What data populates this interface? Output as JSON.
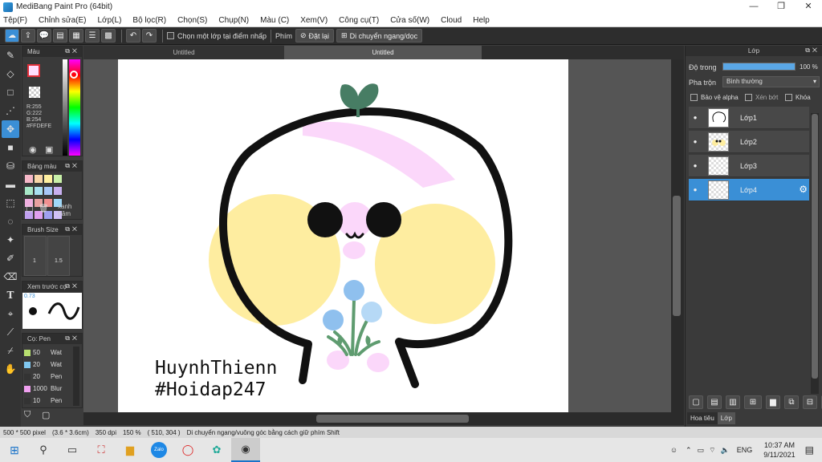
{
  "window": {
    "title": "MediBang Paint Pro (64bit)",
    "controls": [
      "—",
      "❐",
      "✕"
    ]
  },
  "menu": [
    "Tệp(F)",
    "Chỉnh sửa(E)",
    "Lớp(L)",
    "Bộ lọc(R)",
    "Chọn(S)",
    "Chụp(N)",
    "Màu (C)",
    "Xem(V)",
    "Công cụ(T)",
    "Cửa số(W)",
    "Cloud",
    "Help"
  ],
  "toolbar": {
    "sample_label": "Chọn một lớp tại điểm nhấp",
    "key_label": "Phím",
    "reset_label": "Đặt lại",
    "move_label": "Di chuyển ngang/dọc"
  },
  "tabs": [
    "Untitled",
    "Untitled"
  ],
  "color_panel": {
    "title": "Màu",
    "r": "R:255",
    "g": "G:222",
    "b": "B:254",
    "hex": "#FFDEFE",
    "primary": "#ffdefe",
    "secondary": "#e0303a"
  },
  "palette_panel": {
    "title": "Bảng màu",
    "name": "xanh trăm",
    "colors": [
      "#f6b8c8",
      "#f8d6a8",
      "#fff0a0",
      "#c8f0a8",
      "#a8e8c8",
      "#a8e0f0",
      "#a8c8f8",
      "#c8b0f0",
      "#f0b0e0",
      "#e8a0a0",
      "#f09090",
      "#a0d8f8",
      "#c0a0f0",
      "#e0a0f0",
      "#a0a0f0",
      "#d0c0f8"
    ]
  },
  "brush_size_panel": {
    "title": "Brush Size",
    "sizes": [
      "1",
      "1.5"
    ]
  },
  "preview_panel": {
    "title": "Xem trước cọ",
    "value": "0.73"
  },
  "brush_panel": {
    "title": "Cọ: Pen",
    "items": [
      {
        "size": "50",
        "name": "Wat",
        "color": "#b8e070"
      },
      {
        "size": "20",
        "name": "Wat",
        "color": "#80c8f0"
      },
      {
        "size": "20",
        "name": "Pen",
        "color": "#333333"
      },
      {
        "size": "1000",
        "name": "Blur",
        "color": "#f0a0f0"
      },
      {
        "size": "10",
        "name": "Pen",
        "color": "#333333"
      }
    ]
  },
  "canvas_text": {
    "line1": "HuynhThienn",
    "line2": "#Hoidap247"
  },
  "layers_panel": {
    "title": "Lớp",
    "opacity_label": "Độ trong",
    "opacity_value": "100 %",
    "opacity": 1.0,
    "blend_label": "Pha trộn",
    "blend_value": "Bình thường",
    "protect_alpha": "Bảo vệ alpha",
    "clipping": "Xén bớt",
    "lock": "Khóa",
    "layers": [
      "Lớp1",
      "Lớp2",
      "Lớp3",
      "Lớp4"
    ],
    "selected": "Lớp4",
    "bottom_tabs": [
      "Hoa tiêu",
      "Lớp"
    ]
  },
  "status": {
    "size": "500 * 500 pixel",
    "cm": "(3.6 * 3.6cm)",
    "dpi": "350 dpi",
    "zoom": "150 %",
    "coords": "( 510, 304 )",
    "hint": "Di chuyển ngang/vuông góc bằng cách giữ phím Shift"
  },
  "taskbar": {
    "lang": "ENG",
    "time": "10:37 AM",
    "date": "9/11/2021",
    "zalo": "Zalo"
  }
}
